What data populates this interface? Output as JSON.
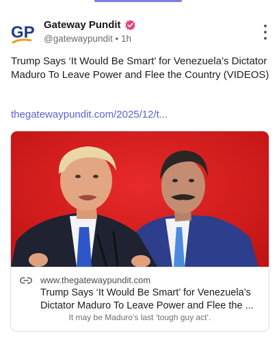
{
  "post": {
    "author_name": "Gateway Pundit",
    "avatar_text": "GP",
    "handle": "@gatewaypundit",
    "separator": "•",
    "time": "1h",
    "text": "Trump Says ‘It Would Be Smart’ for Venezuela’s Dictator Maduro To Leave Power and Flee the Country (VIDEOS)",
    "link": "thegatewaypundit.com/2025/12/t..."
  },
  "link_card": {
    "domain": "www.thegatewaypundit.com",
    "title": "Trump Says ‘It Would Be Smart’ for Venezuela’s Dictator Maduro To Leave Power and Flee the ...",
    "description": "It may be Maduro’s last ‘tough guy act’."
  },
  "colors": {
    "accent": "#5b5fd6",
    "verified_badge": "#e0457b",
    "avatar_blue": "#1f3d7a",
    "avatar_orange": "#f29a1e",
    "image_background": "#d91e1e"
  },
  "icons": {
    "verified": "verified-badge-icon",
    "more": "more-vertical-icon",
    "link": "link-icon"
  }
}
